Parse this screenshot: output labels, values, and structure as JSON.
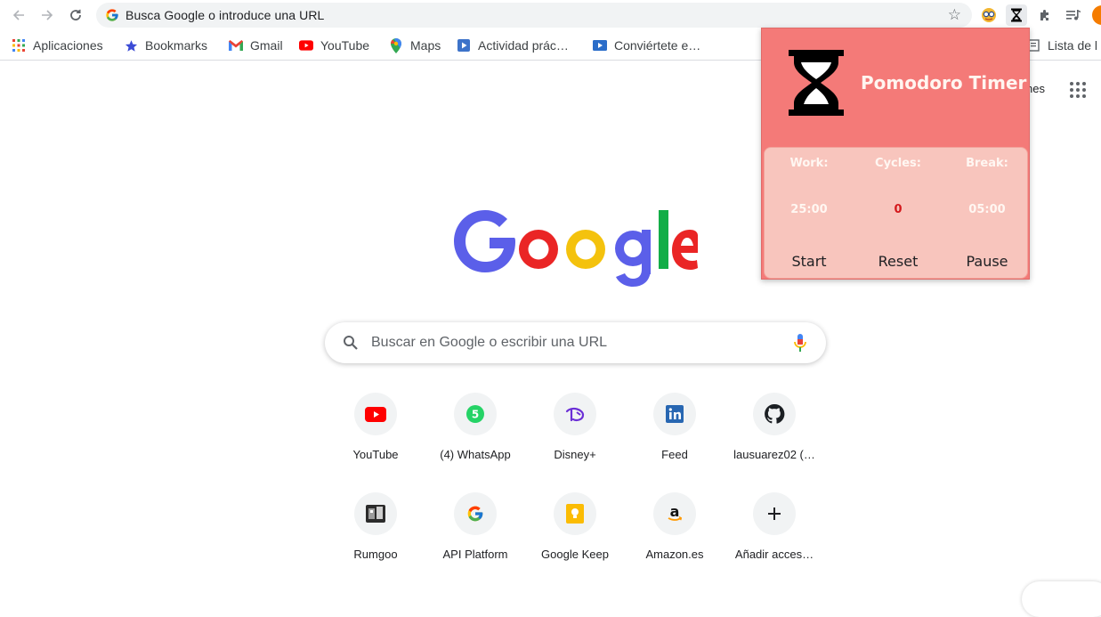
{
  "omnibox": {
    "url_text": "Busca Google o introduce una URL"
  },
  "bookmarks": [
    {
      "label": "Aplicaciones",
      "icon": "apps-grid-icon"
    },
    {
      "label": "Bookmarks",
      "icon": "star-icon"
    },
    {
      "label": "Gmail",
      "icon": "gmail-icon"
    },
    {
      "label": "YouTube",
      "icon": "youtube-icon"
    },
    {
      "label": "Maps",
      "icon": "maps-icon"
    },
    {
      "label": "Actividad prác…",
      "icon": "video-icon"
    },
    {
      "label": "Conviértete e…",
      "icon": "video-icon"
    },
    {
      "label": "Lista de l",
      "icon": "reading-list-icon"
    }
  ],
  "page": {
    "partial_header_text": "nes",
    "search_placeholder": "Buscar en Google o escribir una URL"
  },
  "shortcuts": [
    {
      "label": "YouTube",
      "icon": "youtube-icon"
    },
    {
      "label": "(4) WhatsApp",
      "icon": "whatsapp-icon"
    },
    {
      "label": "Disney+",
      "icon": "disney-icon"
    },
    {
      "label": "Feed",
      "icon": "linkedin-icon"
    },
    {
      "label": "lausuarez02 (…",
      "icon": "github-icon"
    },
    {
      "label": "Rumgoo",
      "icon": "rumgoo-icon"
    },
    {
      "label": "API Platform",
      "icon": "google-icon"
    },
    {
      "label": "Google Keep",
      "icon": "keep-icon"
    },
    {
      "label": "Amazon.es",
      "icon": "amazon-icon"
    },
    {
      "label": "Añadir acces…",
      "icon": "plus-icon"
    }
  ],
  "popup": {
    "title": "Pomodoro Timer",
    "work_label": "Work:",
    "cycles_label": "Cycles:",
    "break_label": "Break:",
    "work_value": "25:00",
    "cycles_value": "0",
    "break_value": "05:00",
    "start_label": "Start",
    "reset_label": "Reset",
    "pause_label": "Pause"
  },
  "colors": {
    "popup_header": "#f47a78",
    "popup_panel": "#f8c5bd",
    "cycles_value": "#d4191c"
  }
}
